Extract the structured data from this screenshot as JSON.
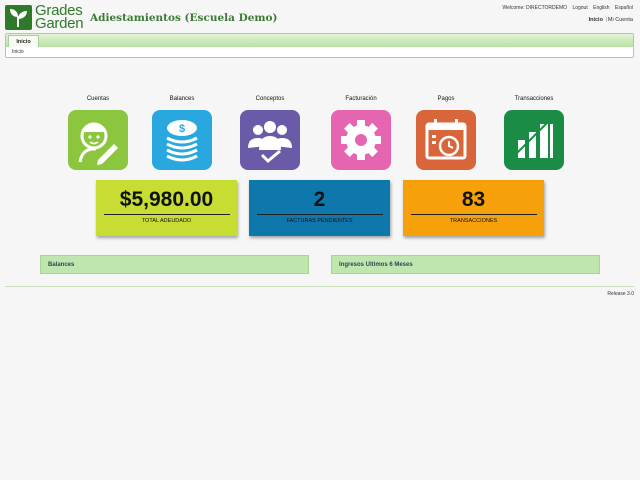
{
  "logo": {
    "line1": "Grades",
    "line2": "Garden"
  },
  "app_title": "Adiestamientos (Escuela Demo)",
  "topnav": {
    "welcome": "Welcome: DIRECTORDEMO",
    "logout": "Logout",
    "english": "English",
    "spanish": "Español"
  },
  "subnav": {
    "home": "Inicio",
    "sep": "|",
    "account": "Mi Cuenta"
  },
  "menubar": {
    "tab": "Inicio",
    "breadcrumb": "Inicio"
  },
  "tiles": [
    {
      "label": "Cuentas",
      "color": "#8cc63f",
      "icon": "student-pencil-icon"
    },
    {
      "label": "Balances",
      "color": "#29a8df",
      "icon": "coin-stack-icon"
    },
    {
      "label": "Conceptos",
      "color": "#6b5aa8",
      "icon": "users-check-icon"
    },
    {
      "label": "Facturación",
      "color": "#e565b0",
      "icon": "gear-icon"
    },
    {
      "label": "Pagos",
      "color": "#d9663a",
      "icon": "calendar-clock-icon"
    },
    {
      "label": "Transacciones",
      "color": "#1a8c46",
      "icon": "bar-chart-icon"
    }
  ],
  "stats": [
    {
      "value": "$5,980.00",
      "caption": "TOTAL ADEUDADO",
      "color": "#c7dd34"
    },
    {
      "value": "2",
      "caption": "FACTURAS PENDIENTES",
      "color": "#0e78ad"
    },
    {
      "value": "83",
      "caption": "TRANSACCIONES",
      "color": "#f6a00c"
    }
  ],
  "panels": {
    "balances": "Balances",
    "ingresos": "Ingresos Ultimos 6 Meses"
  },
  "release": "Release 3.0"
}
